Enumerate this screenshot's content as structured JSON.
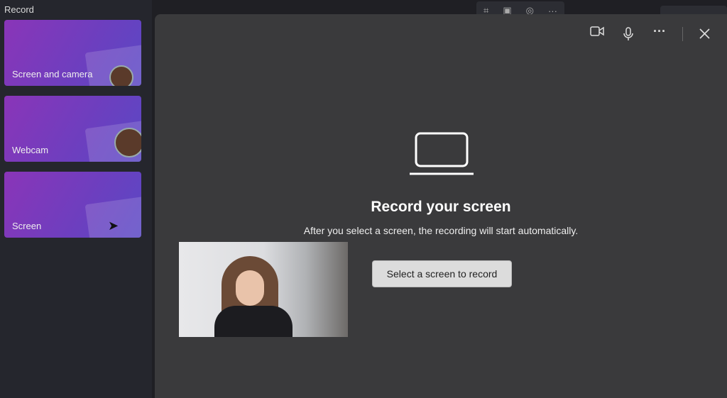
{
  "sidebar": {
    "title": "Record",
    "items": [
      {
        "label": "Screen and camera"
      },
      {
        "label": "Webcam"
      },
      {
        "label": "Screen"
      }
    ]
  },
  "dialog": {
    "heading": "Record your screen",
    "subtitle": "After you select a screen, the recording will start automatically.",
    "button": "Select a screen to record",
    "icons": [
      "camera-icon",
      "microphone-icon",
      "more-icon",
      "close-icon"
    ]
  }
}
